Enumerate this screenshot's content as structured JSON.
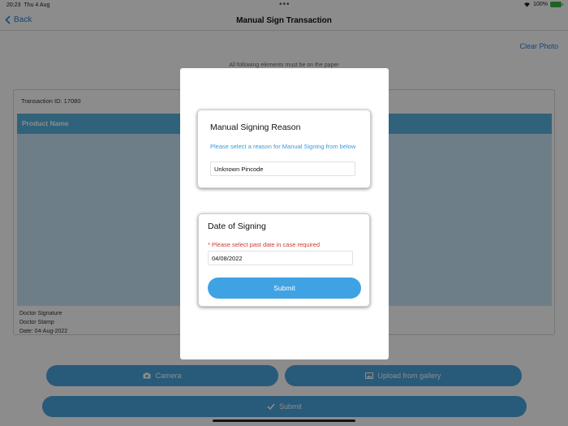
{
  "status_bar": {
    "time": "20:23",
    "date": "Thu 4 Aug",
    "battery": "100%"
  },
  "nav": {
    "back_label": "Back",
    "title": "Manual Sign Transaction"
  },
  "toolbar": {
    "clear_photo_label": "Clear Photo"
  },
  "notice": "All following elements must be on the paper",
  "transaction": {
    "id_label": "Transaction ID: 17080",
    "table_header": "Product Name",
    "signature_lines": [
      "Doctor Signature",
      "Doctor Stamp",
      "Date: 04-Aug-2022"
    ]
  },
  "actions": {
    "camera_label": "Camera",
    "gallery_label": "Upload from gallery",
    "submit_label": "Submit"
  },
  "dialog": {
    "reason": {
      "title": "Manual Signing Reason",
      "hint": "Please select a reason for Manual Signing from below",
      "selected_value": "Unknown Pincode"
    },
    "date": {
      "title": "Date of Signing",
      "hint": "* Please select past date in case required",
      "value": "04/08/2022",
      "submit_label": "Submit"
    }
  },
  "colors": {
    "accent": "#4aa4df",
    "link": "#2f7fd3",
    "table_header": "#5ab2e0",
    "warning": "#d03a2f"
  }
}
